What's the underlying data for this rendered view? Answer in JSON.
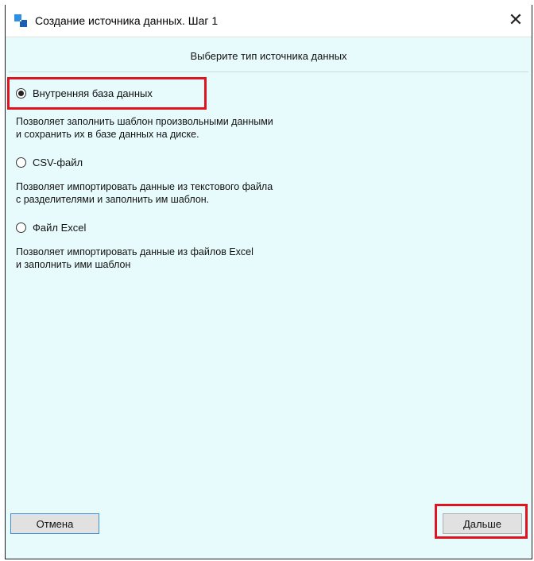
{
  "window": {
    "title": "Создание источника данных. Шаг 1",
    "close_glyph": "✕",
    "icon": "app-logo-icon"
  },
  "header": {
    "label": "Выберите тип источника данных"
  },
  "options": [
    {
      "label": "Внутренняя база данных",
      "checked": true,
      "description_line1": "Позволяет заполнить шаблон произвольными данными",
      "description_line2": "и сохранить их в базе данных на диске."
    },
    {
      "label": "CSV-файл",
      "checked": false,
      "description_line1": "Позволяет импортировать данные из текстового файла",
      "description_line2": "с разделителями и заполнить им шаблон."
    },
    {
      "label": "Файл Excel",
      "checked": false,
      "description_line1": "Позволяет импортировать данные из файлов Excel",
      "description_line2": "и заполнить ими шаблон"
    }
  ],
  "buttons": {
    "cancel_label": "Отмена",
    "next_label": "Дальше"
  },
  "colors": {
    "background": "#e8fbfc",
    "highlight": "#e0141e",
    "focus_border": "#3c8fd8"
  }
}
